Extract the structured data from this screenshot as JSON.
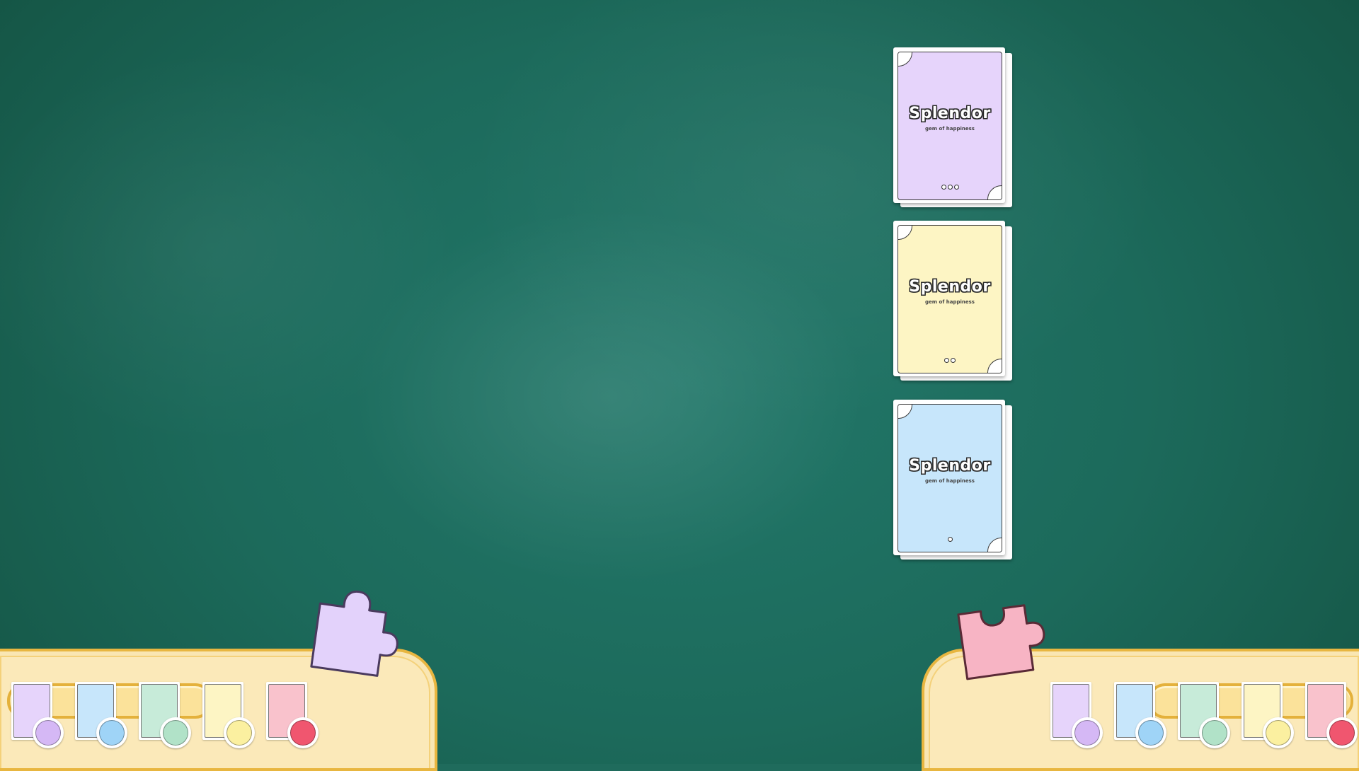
{
  "colors": {
    "board": "#1f6b5c",
    "tray_fill": "#f9e6b3",
    "tray_border": "#e8b640",
    "purple": "#e6d4fb",
    "yellow": "#fdf5c4",
    "blue": "#c7e6fb",
    "green": "#c7ebd9",
    "pink": "#f9c2cc",
    "token_purple": "#d5b8f5",
    "token_blue": "#9fd4f7",
    "token_green": "#b1e2c8",
    "token_yellow": "#fbf0a0",
    "token_red": "#f0566f"
  },
  "decks": [
    {
      "id": "tier-3",
      "title": "Splendor",
      "subtitle": "gem of happiness",
      "level": 3,
      "color": "#e6d4fb"
    },
    {
      "id": "tier-2",
      "title": "Splendor",
      "subtitle": "gem of happiness",
      "level": 2,
      "color": "#fdf5c4"
    },
    {
      "id": "tier-1",
      "title": "Splendor",
      "subtitle": "gem of happiness",
      "level": 1,
      "color": "#c7e6fb"
    }
  ],
  "players": [
    {
      "side": "left",
      "name": "",
      "puzzle_icon": "puzzle-piece-purple-icon",
      "slots": [
        {
          "gem": "purple",
          "card": "#e6d4fb",
          "token": "#d5b8f5"
        },
        {
          "gem": "blue",
          "card": "#c7e6fb",
          "token": "#9fd4f7"
        },
        {
          "gem": "green",
          "card": "#c7ebd9",
          "token": "#b1e2c8"
        },
        {
          "gem": "yellow",
          "card": "#fdf5c4",
          "token": "#fbf0a0"
        },
        {
          "gem": "red",
          "card": "#f9c2cc",
          "token": "#f0566f"
        }
      ]
    },
    {
      "side": "right",
      "name": "",
      "puzzle_icon": "puzzle-piece-pink-icon",
      "slots": [
        {
          "gem": "purple",
          "card": "#e6d4fb",
          "token": "#d5b8f5"
        },
        {
          "gem": "blue",
          "card": "#c7e6fb",
          "token": "#9fd4f7"
        },
        {
          "gem": "green",
          "card": "#c7ebd9",
          "token": "#b1e2c8"
        },
        {
          "gem": "yellow",
          "card": "#fdf5c4",
          "token": "#fbf0a0"
        },
        {
          "gem": "red",
          "card": "#f9c2cc",
          "token": "#f0566f"
        }
      ]
    }
  ]
}
